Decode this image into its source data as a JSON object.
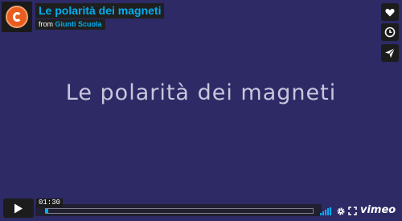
{
  "video": {
    "title": "Le polarità dei magneti",
    "byline_prefix": "from",
    "owner": "Giunti Scuola",
    "screen_text": "Le polarità dei magneti"
  },
  "controls": {
    "time": "01:30",
    "progress": 0.01,
    "brand": "vimeo"
  },
  "icons": {
    "like": "heart-icon",
    "watch_later": "clock-icon",
    "share": "paper-plane-icon",
    "play": "play-icon",
    "volume": "volume-icon",
    "settings": "gear-icon",
    "fullscreen": "fullscreen-icon"
  },
  "colors": {
    "background": "#2d2a66",
    "accent": "#00adef",
    "logo": "#e85d1f"
  }
}
